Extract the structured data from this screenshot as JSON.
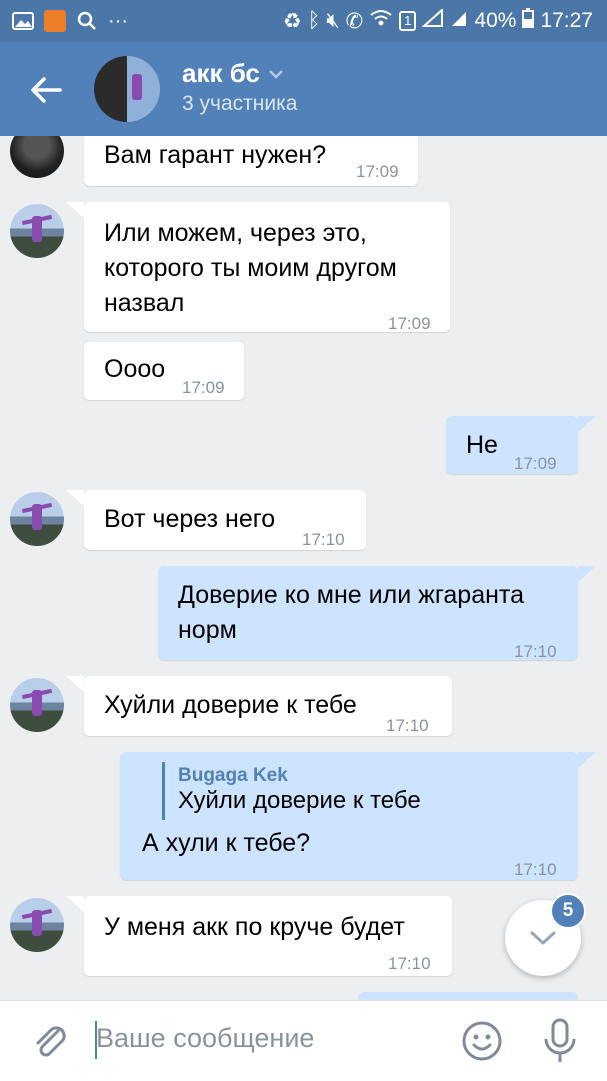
{
  "status_bar": {
    "battery_percent": "40%",
    "time": "17:27",
    "sim_badge": "1",
    "dots": "···"
  },
  "header": {
    "title": "акк бс",
    "subtitle": "3 участника"
  },
  "messages": [
    {
      "text": "Вам гарант нужен?",
      "time": "17:09"
    },
    {
      "text": "Или можем, через это, которого ты моим другом назвал",
      "time": "17:09"
    },
    {
      "text": "Оооо",
      "time": "17:09"
    },
    {
      "text": "Не",
      "time": "17:09"
    },
    {
      "text": "Вот через него",
      "time": "17:10"
    },
    {
      "text": "Доверие ко мне или жгаранта норм",
      "time": "17:10"
    },
    {
      "text": "Хуйли доверие к тебе",
      "time": "17:10"
    },
    {
      "reply_author": "Bugaga Kek",
      "reply_text": "Хуйли доверие к тебе",
      "text": "А хули к тебе?",
      "time": "17:10"
    },
    {
      "text": "У меня акк по круче будет",
      "time": "17:10"
    }
  ],
  "scroll_down": {
    "unread_count": "5"
  },
  "composer": {
    "placeholder": "Ваше сообщение"
  },
  "colors": {
    "header": "#5181b8",
    "status_bar": "#4a76a8",
    "outgoing_bubble": "#cce4ff",
    "background": "#edeef0"
  }
}
